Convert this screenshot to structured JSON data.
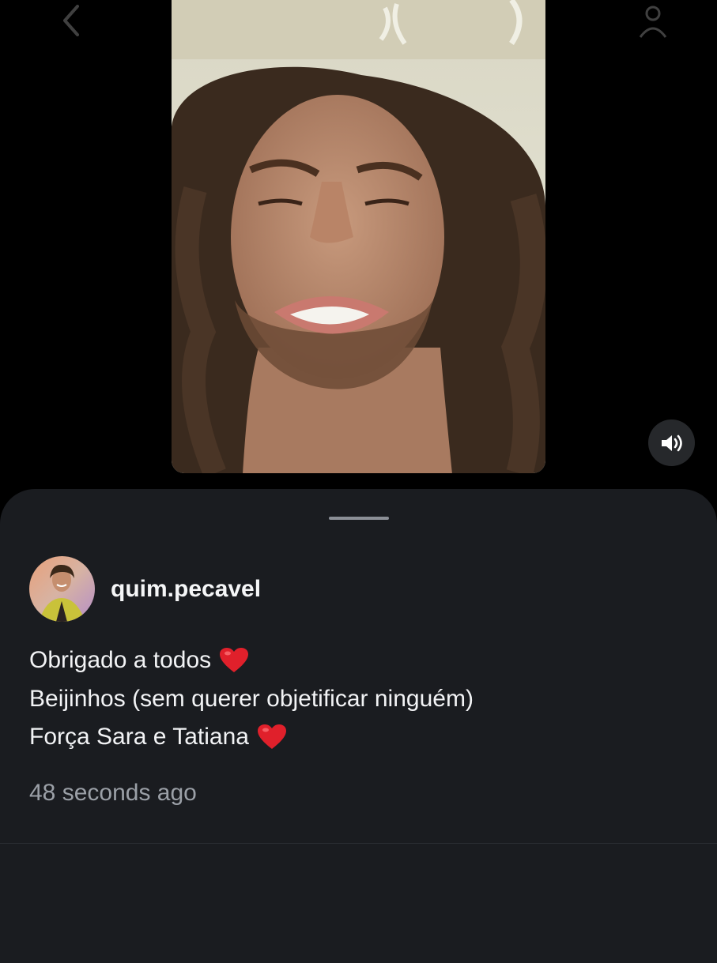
{
  "story": {
    "back_icon": "chevron-left-icon",
    "profile_icon": "profile-settings-icon",
    "video_alt": "video-frame",
    "sound_icon": "speaker-on-icon"
  },
  "post": {
    "username": "quim.pecavel",
    "caption_lines": [
      "Obrigado a todos",
      "Beijinhos (sem querer objetificar ninguém)",
      "Força Sara e Tatiana"
    ],
    "timestamp": "48 seconds ago"
  },
  "colors": {
    "sheet_bg": "#1a1c20",
    "heart": "#e0202b",
    "timestamp": "#9ba0a7"
  }
}
